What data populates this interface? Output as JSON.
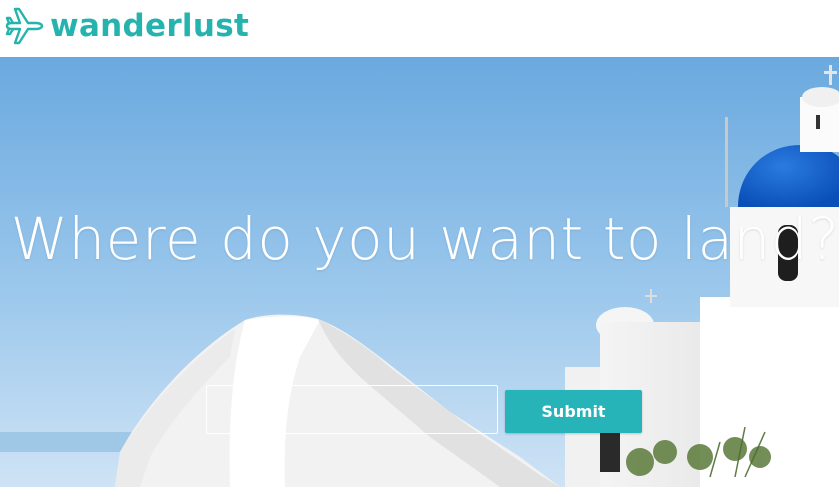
{
  "brand": {
    "name": "wanderlust",
    "icon": "airplane-icon",
    "color": "#26b3ad"
  },
  "hero": {
    "headline": "Where do you want to land?",
    "input": {
      "value": "",
      "placeholder": ""
    },
    "submit_label": "Submit",
    "button_color": "#27b4b8"
  }
}
